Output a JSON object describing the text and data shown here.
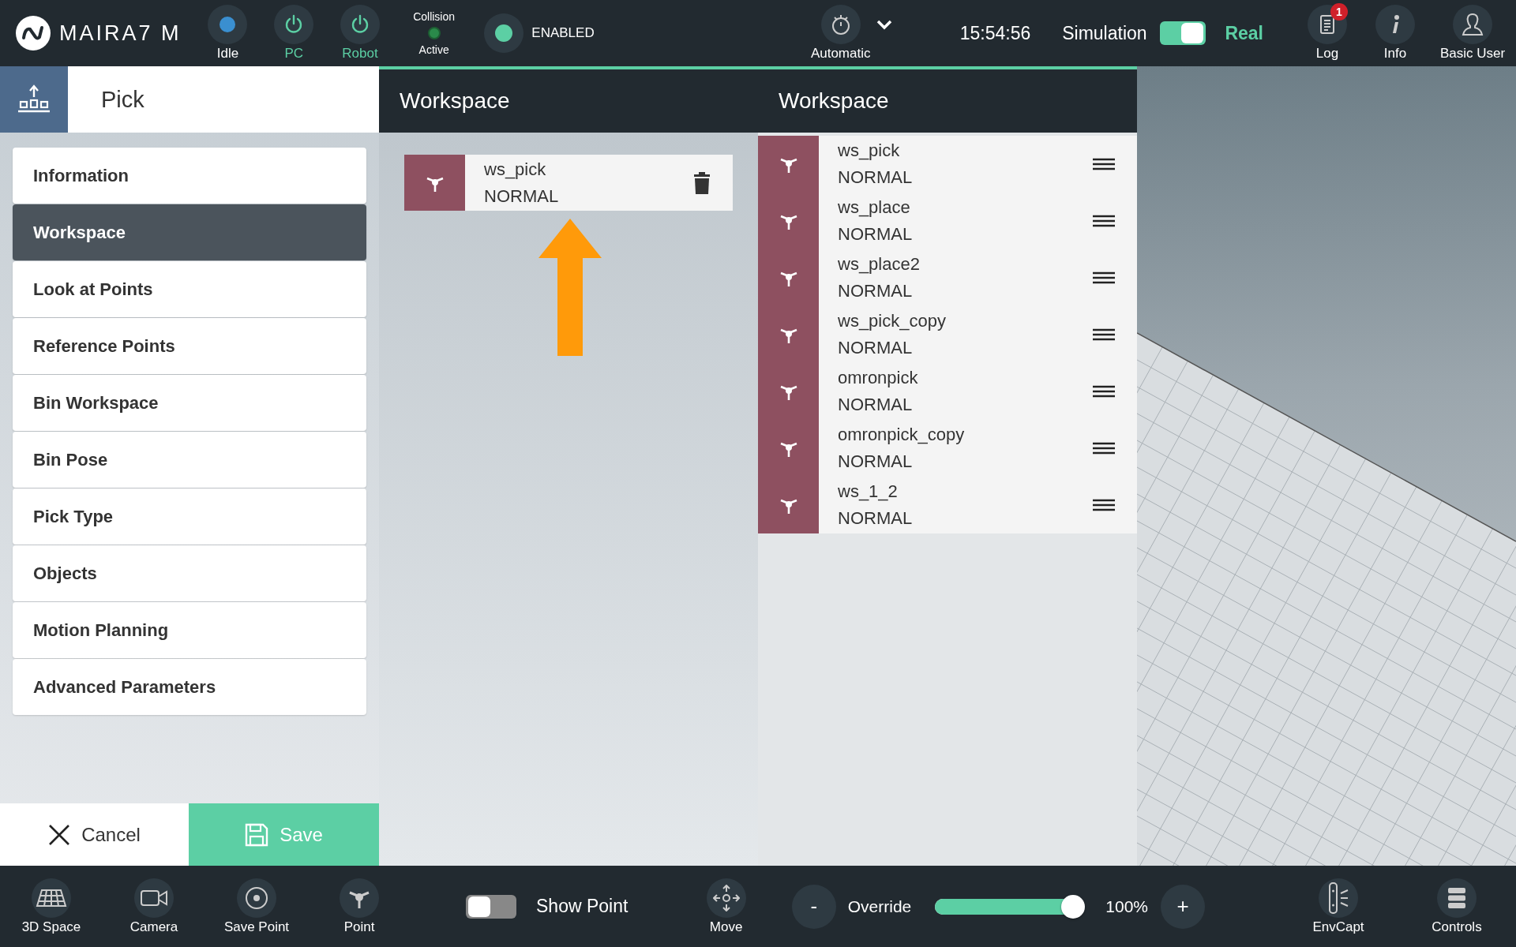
{
  "header": {
    "logo_text": "MAIRA7 M",
    "status": [
      {
        "label": "Idle",
        "kind": "dot",
        "active": false
      },
      {
        "label": "PC",
        "kind": "power",
        "active": true
      },
      {
        "label": "Robot",
        "kind": "power",
        "active": true
      }
    ],
    "collision": {
      "title": "Collision",
      "state": "Active"
    },
    "enabled": {
      "label": "ENABLED"
    },
    "mode": {
      "label": "Automatic"
    },
    "time": "15:54:56",
    "sim_toggle": {
      "left": "Simulation",
      "right": "Real",
      "on": true
    },
    "actions": [
      {
        "label": "Log",
        "kind": "log",
        "badge": "1"
      },
      {
        "label": "Info",
        "kind": "info"
      },
      {
        "label": "Basic User",
        "kind": "user"
      }
    ]
  },
  "sidebar": {
    "title": "Pick",
    "items": [
      {
        "label": "Information",
        "selected": false
      },
      {
        "label": "Workspace",
        "selected": true
      },
      {
        "label": "Look at Points",
        "selected": false
      },
      {
        "label": "Reference Points",
        "selected": false
      },
      {
        "label": "Bin Workspace",
        "selected": false
      },
      {
        "label": "Bin Pose",
        "selected": false
      },
      {
        "label": "Pick Type",
        "selected": false
      },
      {
        "label": "Objects",
        "selected": false
      },
      {
        "label": "Motion Planning",
        "selected": false
      },
      {
        "label": "Advanced Parameters",
        "selected": false
      }
    ],
    "cancel": "Cancel",
    "save": "Save"
  },
  "selected_panel": {
    "title": "Workspace",
    "items": [
      {
        "name": "ws_pick",
        "mode": "NORMAL"
      }
    ]
  },
  "available_panel": {
    "title": "Workspace",
    "items": [
      {
        "name": "ws_pick",
        "mode": "NORMAL"
      },
      {
        "name": "ws_place",
        "mode": "NORMAL"
      },
      {
        "name": "ws_place2",
        "mode": "NORMAL"
      },
      {
        "name": "ws_pick_copy",
        "mode": "NORMAL"
      },
      {
        "name": "omronpick",
        "mode": "NORMAL"
      },
      {
        "name": "omronpick_copy",
        "mode": "NORMAL"
      },
      {
        "name": "ws_1_2",
        "mode": "NORMAL"
      }
    ]
  },
  "bottom_bar": {
    "tools": [
      {
        "label": "3D Space",
        "kind": "grid"
      },
      {
        "label": "Camera",
        "kind": "camera"
      },
      {
        "label": "Save Point",
        "kind": "target"
      },
      {
        "label": "Point",
        "kind": "point"
      }
    ],
    "show_point": {
      "label": "Show Point",
      "on": false
    },
    "move": {
      "label": "Move"
    },
    "override": {
      "label": "Override",
      "minus": "-",
      "plus": "+",
      "level": 1.0,
      "reading": "100%"
    },
    "right_tools": [
      {
        "label": "EnvCapt",
        "kind": "envcapt"
      },
      {
        "label": "Controls",
        "kind": "controls"
      }
    ]
  }
}
